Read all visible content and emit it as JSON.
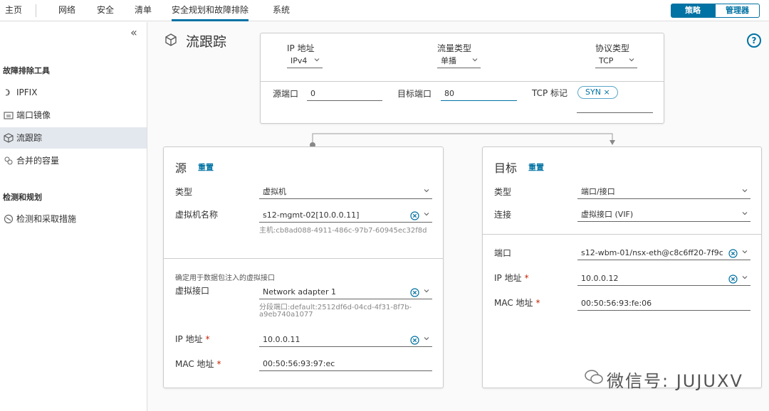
{
  "nav": {
    "tabs": [
      "主页",
      "网络",
      "安全",
      "清单",
      "安全规划和故障排除",
      "系统"
    ],
    "active_tab": "安全规划和故障排除",
    "policy_label": "策略",
    "manager_label": "管理器"
  },
  "sidebar": {
    "section1": "故障排除工具",
    "items1": [
      "IPFIX",
      "端口镜像",
      "流跟踪",
      "合并的容量"
    ],
    "section2": "检测和规划",
    "items2": [
      "检测和采取措施"
    ]
  },
  "page": {
    "title": "流跟踪"
  },
  "settings": {
    "ip_label": "IP 地址",
    "ip_value": "IPv4",
    "traffic_label": "流量类型",
    "traffic_value": "单播",
    "proto_label": "协议类型",
    "proto_value": "TCP",
    "src_port_label": "源端口",
    "src_port_value": "0",
    "dst_port_label": "目标端口",
    "dst_port_value": "80",
    "tcp_flag_label": "TCP 标记",
    "tcp_flag_chip": "SYN"
  },
  "source": {
    "title": "源",
    "reset": "重置",
    "type_label": "类型",
    "type_value": "虚拟机",
    "vm_label": "虚拟机名称",
    "vm_value": "s12-mgmt-02[10.0.0.11]",
    "vm_helper": "主机:cb8ad088-4911-486c-97b7-60945ec32f8d",
    "inject_note": "确定用于数据包注入的虚拟接口",
    "vif_label": "虚拟接口",
    "vif_value": "Network adapter 1",
    "vif_helper": "分段端口:default:2512df6d-04cd-4f31-8f7b-a9eb740a1077",
    "ip_label": "IP 地址",
    "ip_value": "10.0.0.11",
    "mac_label": "MAC 地址",
    "mac_value": "00:50:56:93:97:ec"
  },
  "destination": {
    "title": "目标",
    "reset": "重置",
    "type_label": "类型",
    "type_value": "端口/接口",
    "conn_label": "连接",
    "conn_value": "虚拟接口 (VIF)",
    "port_label": "端口",
    "port_value": "s12-wbm-01/nsx-eth@c8c6ff20-7f9c",
    "ip_label": "IP 地址",
    "ip_value": "10.0.0.12",
    "mac_label": "MAC 地址",
    "mac_value": "00:50:56:93:fe:06"
  },
  "watermark": "微信号: JUJUXV",
  "colors": {
    "accent": "#0072a3",
    "required": "#c92100"
  }
}
